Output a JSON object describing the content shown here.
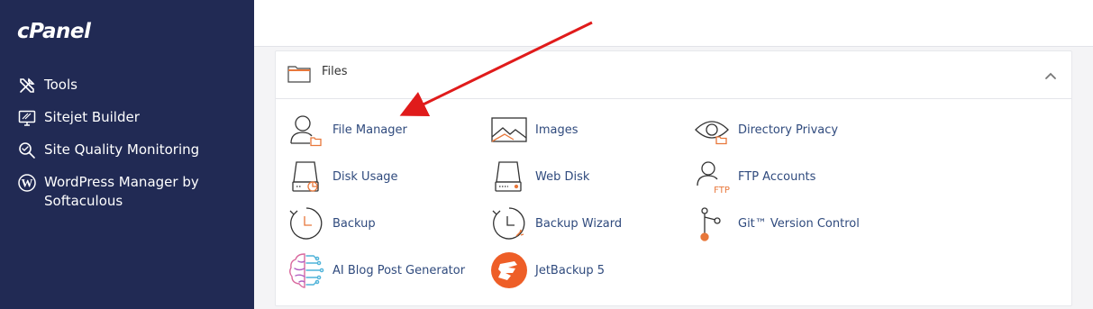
{
  "brand": {
    "logo_text": "cPanel"
  },
  "sidebar": {
    "items": [
      {
        "label": "Tools",
        "icon": "tools-icon"
      },
      {
        "label": "Sitejet Builder",
        "icon": "sitejet-icon"
      },
      {
        "label": "Site Quality Monitoring",
        "icon": "search-icon"
      },
      {
        "label": "WordPress Manager by Softaculous",
        "line1": "WordPress Manager by",
        "line2": "Softaculous",
        "icon": "wordpress-icon"
      }
    ]
  },
  "files_panel": {
    "title": "Files",
    "tools": [
      {
        "label": "File Manager",
        "icon": "file-manager-icon"
      },
      {
        "label": "Images",
        "icon": "images-icon"
      },
      {
        "label": "Directory Privacy",
        "icon": "directory-privacy-icon"
      },
      {
        "label": "Disk Usage",
        "icon": "disk-usage-icon"
      },
      {
        "label": "Web Disk",
        "icon": "web-disk-icon"
      },
      {
        "label": "FTP Accounts",
        "icon": "ftp-accounts-icon",
        "icon_text": "FTP"
      },
      {
        "label": "Backup",
        "icon": "backup-icon"
      },
      {
        "label": "Backup Wizard",
        "icon": "backup-wizard-icon"
      },
      {
        "label": "Git™ Version Control",
        "icon": "git-icon"
      },
      {
        "label": "AI Blog Post Generator",
        "icon": "ai-brain-icon"
      },
      {
        "label": "JetBackup 5",
        "icon": "jetbackup-icon"
      }
    ]
  },
  "colors": {
    "sidebar_bg": "#212a54",
    "link": "#2f4a7d",
    "accent_orange": "#e8773a",
    "arrow_red": "#e01b1b"
  }
}
